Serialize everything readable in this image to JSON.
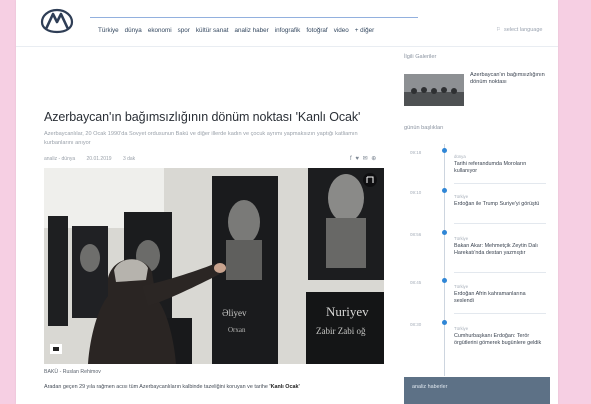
{
  "header": {
    "nav": [
      "Türkiye",
      "dünya",
      "ekonomi",
      "spor",
      "kültür sanat",
      "analiz haber",
      "infografik",
      "fotoğraf",
      "video",
      "+ diğer"
    ],
    "language_label": "select language"
  },
  "article": {
    "title": "Azerbaycan'ın bağımsızlığının dönüm noktası 'Kanlı Ocak'",
    "subtitle": "Azerbaycanlılar, 20 Ocak 1990'da Sovyet ordusunun Bakü ve diğer illerde kadın ve çocuk ayrımı yapmaksızın yaptığı katliamın kurbanlarını anıyor",
    "meta": [
      "analiz - dünya",
      "20.01.2019",
      "3 dak"
    ],
    "share": "f ♥ ✉ ⊕",
    "photo_names": [
      "Əliyev",
      "Orxan",
      "Nuriyev",
      "Zabir Zabi oğ"
    ],
    "caption": "BAKÜ - Ruslan Rehimov",
    "body_text": "Aradan geçen 29 yıla rağmen acısı tüm Azerbaycanlıların kalbinde tazeliğini koruyan ve tarihe ",
    "body_bold": "'Kanlı Ocak'"
  },
  "sidebar": {
    "gallery_heading": "İlgili Galeriler",
    "gallery_title": "Azerbaycan'ın bağımsızlığının dönüm noktası",
    "today_heading": "günün başlıkları",
    "timeline": [
      {
        "time": "09:18",
        "category": "dünya",
        "title": "Tarihi referandumda Moroların kullanıyor"
      },
      {
        "time": "09:10",
        "category": "Türkiye",
        "title": "Erdoğan ile Trump Suriye'yi görüştü"
      },
      {
        "time": "08:56",
        "category": "Türkiye",
        "title": "Bakan Akar: Mehmetçik Zeytin Dalı Harekatı'nda destan yazmıştır"
      },
      {
        "time": "08:45",
        "category": "Türkiye",
        "title": "Erdoğan Afrin kahramanlarına seslendi"
      },
      {
        "time": "08:30",
        "category": "Türkiye",
        "title": "Cumhurbaşkanı Erdoğan: Terör örgütlerini gömerek bugünlere geldik"
      }
    ],
    "bottom_heading": "analiz haberler"
  }
}
